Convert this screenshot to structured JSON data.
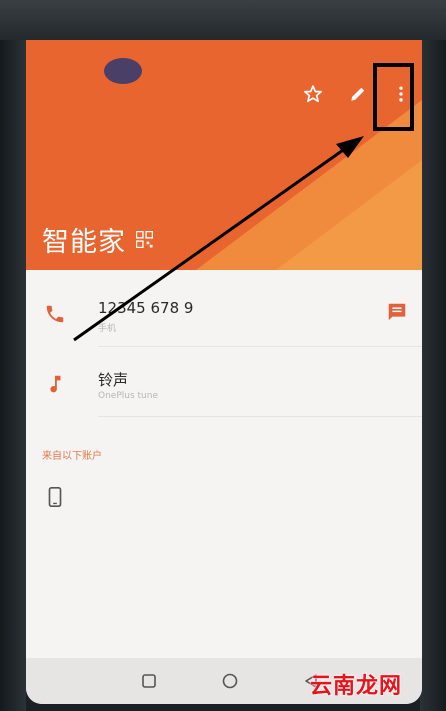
{
  "contact": {
    "name": "智能家",
    "phone_number": "12345 678 9",
    "phone_type": "手机",
    "ringtone_label": "铃声",
    "ringtone_value": "OnePlus tune"
  },
  "accounts_section_label": "来自以下账户",
  "watermark": "云南龙网",
  "colors": {
    "header": "#e9652f",
    "header_accent": "#f2903a",
    "accent_icon": "#e0623a"
  }
}
